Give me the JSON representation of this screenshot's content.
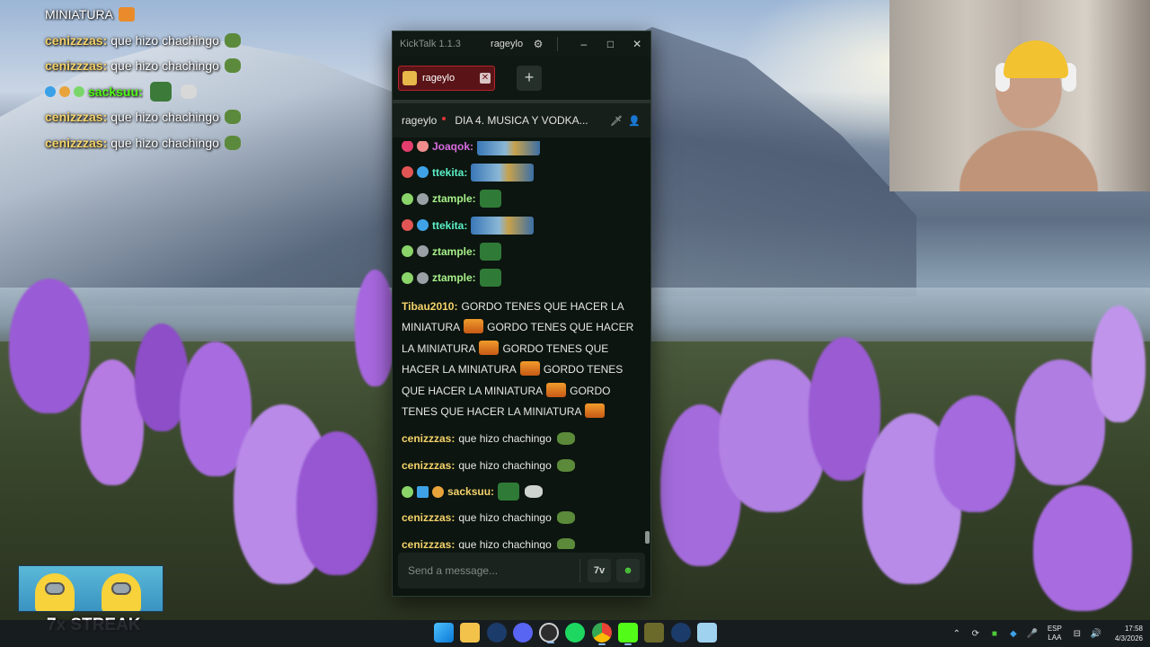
{
  "overlay_chat": [
    {
      "user": "",
      "text": "MINIATURA",
      "emote": "fire-emote"
    },
    {
      "user": "cenizzzas:",
      "text": "que hizo chachingo",
      "emote": "frog-emote"
    },
    {
      "user": "cenizzzas:",
      "text": "que hizo chachingo",
      "emote": "frog-emote"
    },
    {
      "user": "sacksuu:",
      "text": "",
      "emote": "pepe-emote"
    },
    {
      "user": "cenizzzas:",
      "text": "que hizo chachingo",
      "emote": "frog-emote"
    },
    {
      "user": "cenizzzas:",
      "text": "que hizo chachingo",
      "emote": "frog-emote"
    }
  ],
  "streak_widget": {
    "label": "7x STREAK"
  },
  "kicktalk": {
    "app_title": "KickTalk 1.1.3",
    "account": "rageylo",
    "tab": {
      "label": "rageylo",
      "close": "✕"
    },
    "add_tab": "+",
    "channel": {
      "name": "rageylo",
      "title": "DIA 4. MUSICA Y VODKA..."
    },
    "messages": [
      {
        "user": "Joaqok:",
        "user_color": "#d96be0",
        "content": "",
        "emote": "wide"
      },
      {
        "user": "ttekita:",
        "user_color": "#5cf0c8",
        "content": "",
        "emote": "wide"
      },
      {
        "user": "ztample:",
        "user_color": "#a7f08a",
        "content": "",
        "emote": "box"
      },
      {
        "user": "ttekita:",
        "user_color": "#5cf0c8",
        "content": "",
        "emote": "wide"
      },
      {
        "user": "ztample:",
        "user_color": "#a7f08a",
        "content": "",
        "emote": "box"
      },
      {
        "user": "ztample:",
        "user_color": "#a7f08a",
        "content": "",
        "emote": "box"
      }
    ],
    "long_message": {
      "user": "Tibau2010:",
      "user_color": "#f5d36b",
      "parts": [
        "GORDO TENES QUE HACER LA MINIATURA",
        "GORDO TENES QUE HACER LA MINIATURA",
        "GORDO TENES QUE HACER LA MINIATURA",
        "GORDO TENES QUE HACER LA MINIATURA",
        "GORDO TENES QUE HACER LA MINIATURA"
      ]
    },
    "tail_messages": [
      {
        "user": "cenizzzas:",
        "user_color": "#f5d36b",
        "content": "que hizo chachingo"
      },
      {
        "user": "cenizzzas:",
        "user_color": "#f5d36b",
        "content": "que hizo chachingo"
      },
      {
        "user": "sacksuu:",
        "user_color": "#f5d36b",
        "content": ""
      },
      {
        "user": "cenizzzas:",
        "user_color": "#f5d36b",
        "content": "que hizo chachingo"
      },
      {
        "user": "cenizzzas:",
        "user_color": "#f5d36b",
        "content": "que hizo chachingo"
      }
    ],
    "input_placeholder": "Send a message...",
    "translate_btn": "7tv",
    "emote_btn": "kick-emote-icon"
  },
  "taskbar": {
    "apps": [
      "windows-start-icon",
      "file-explorer-icon",
      "steam-icon",
      "discord-icon",
      "obs-icon",
      "spotify-icon",
      "chrome-icon",
      "kick-icon",
      "app-icon",
      "steam-alt-icon",
      "notepad-icon"
    ],
    "lang_top": "ESP",
    "lang_bottom": "LAA",
    "time": "17:58",
    "date": "4/3/2026"
  }
}
